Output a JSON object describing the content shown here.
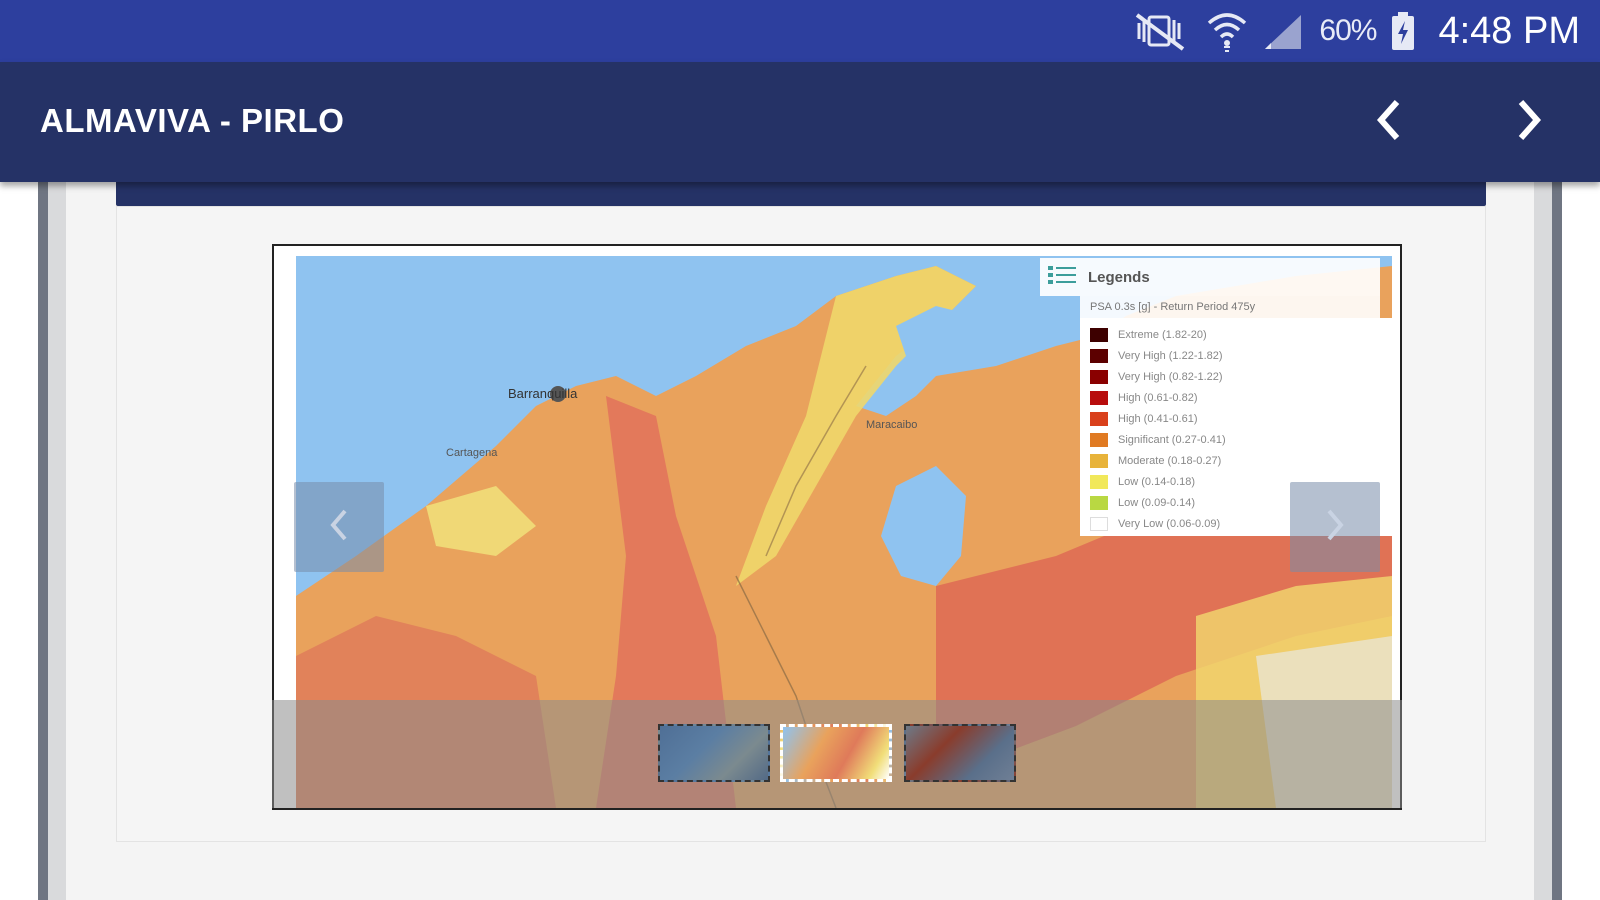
{
  "status_bar": {
    "battery": "60%",
    "time": "4:48 PM",
    "icons": [
      "mute-vibrate-icon",
      "wifi-icon",
      "signal-icon",
      "battery-charging-icon"
    ]
  },
  "app_bar": {
    "title": "ALMAVIVA - PIRLO",
    "prev_icon": "chevron-left-icon",
    "next_icon": "chevron-right-icon"
  },
  "legend": {
    "title": "Legends",
    "subtitle": "PSA 0.3s [g] - Return Period 475y",
    "items": [
      {
        "label": "Extreme (1.82-20)",
        "color": "#3d0000"
      },
      {
        "label": "Very High (1.22-1.82)",
        "color": "#5c0000"
      },
      {
        "label": "Very High (0.82-1.22)",
        "color": "#8a0000"
      },
      {
        "label": "High (0.61-0.82)",
        "color": "#b80d0d"
      },
      {
        "label": "High (0.41-0.61)",
        "color": "#d9401b"
      },
      {
        "label": "Significant (0.27-0.41)",
        "color": "#e07a22"
      },
      {
        "label": "Moderate (0.18-0.27)",
        "color": "#e8b33a"
      },
      {
        "label": "Low (0.14-0.18)",
        "color": "#f1e85a"
      },
      {
        "label": "Low (0.09-0.14)",
        "color": "#b9d842"
      },
      {
        "label": "Very Low (0.06-0.09)",
        "color": "#ffffff"
      }
    ]
  },
  "map_labels": {
    "city_1": "Barranquilla",
    "city_2": "Maracaibo",
    "city_3": "Cartagena"
  },
  "carousel": {
    "prev_icon": "carousel-prev-icon",
    "next_icon": "carousel-next-icon",
    "thumbnails": 3,
    "active_index": 1
  }
}
